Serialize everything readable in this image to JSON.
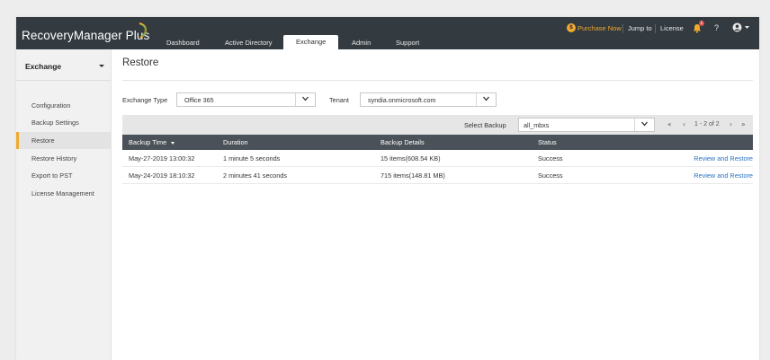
{
  "app": {
    "name": "RecoveryManager Plus"
  },
  "nav": {
    "tabs": [
      {
        "label": "Dashboard"
      },
      {
        "label": "Active Directory"
      },
      {
        "label": "Exchange",
        "active": true
      },
      {
        "label": "Admin"
      },
      {
        "label": "Support"
      }
    ]
  },
  "topright": {
    "purchase_label": "Purchase Now",
    "jump_label": "Jump to",
    "license_label": "License",
    "notification_count": "1",
    "help_label": "?"
  },
  "sidebar": {
    "title": "Exchange",
    "items": [
      {
        "label": "Configuration"
      },
      {
        "label": "Backup Settings"
      },
      {
        "label": "Restore",
        "active": true
      },
      {
        "label": "Restore History"
      },
      {
        "label": "Export to PST"
      },
      {
        "label": "License Management"
      }
    ]
  },
  "page": {
    "title": "Restore",
    "exchange_type_label": "Exchange Type",
    "exchange_type_value": "Office 365",
    "tenant_label": "Tenant",
    "tenant_value": "syndia.onmicrosoft.com",
    "select_backup_label": "Select Backup",
    "select_backup_value": "all_mbxs",
    "pager": {
      "first": "«",
      "prev": "‹",
      "range": "1 - 2 of 2",
      "next": "›",
      "last": "»"
    }
  },
  "table": {
    "headers": [
      "Backup Time",
      "Duration",
      "Backup Details",
      "Status",
      ""
    ],
    "rows": [
      [
        "May-27-2019 13:00:32",
        "1 minute 5 seconds",
        "15 items(608.54 KB)",
        "Success",
        "Review and Restore"
      ],
      [
        "May-24-2019 18:10:32",
        "2 minutes 41 seconds",
        "715 items(148.81 MB)",
        "Success",
        "Review and Restore"
      ]
    ]
  },
  "colors": {
    "topbar": "#333a40",
    "accent": "#f0a92e",
    "table_header": "#4a5158",
    "link": "#2a72c0"
  },
  "icons": [
    "logo-swoosh-icon",
    "coin-icon",
    "bell-icon",
    "user-icon",
    "chevron-down-icon",
    "sort-caret-icon"
  ]
}
